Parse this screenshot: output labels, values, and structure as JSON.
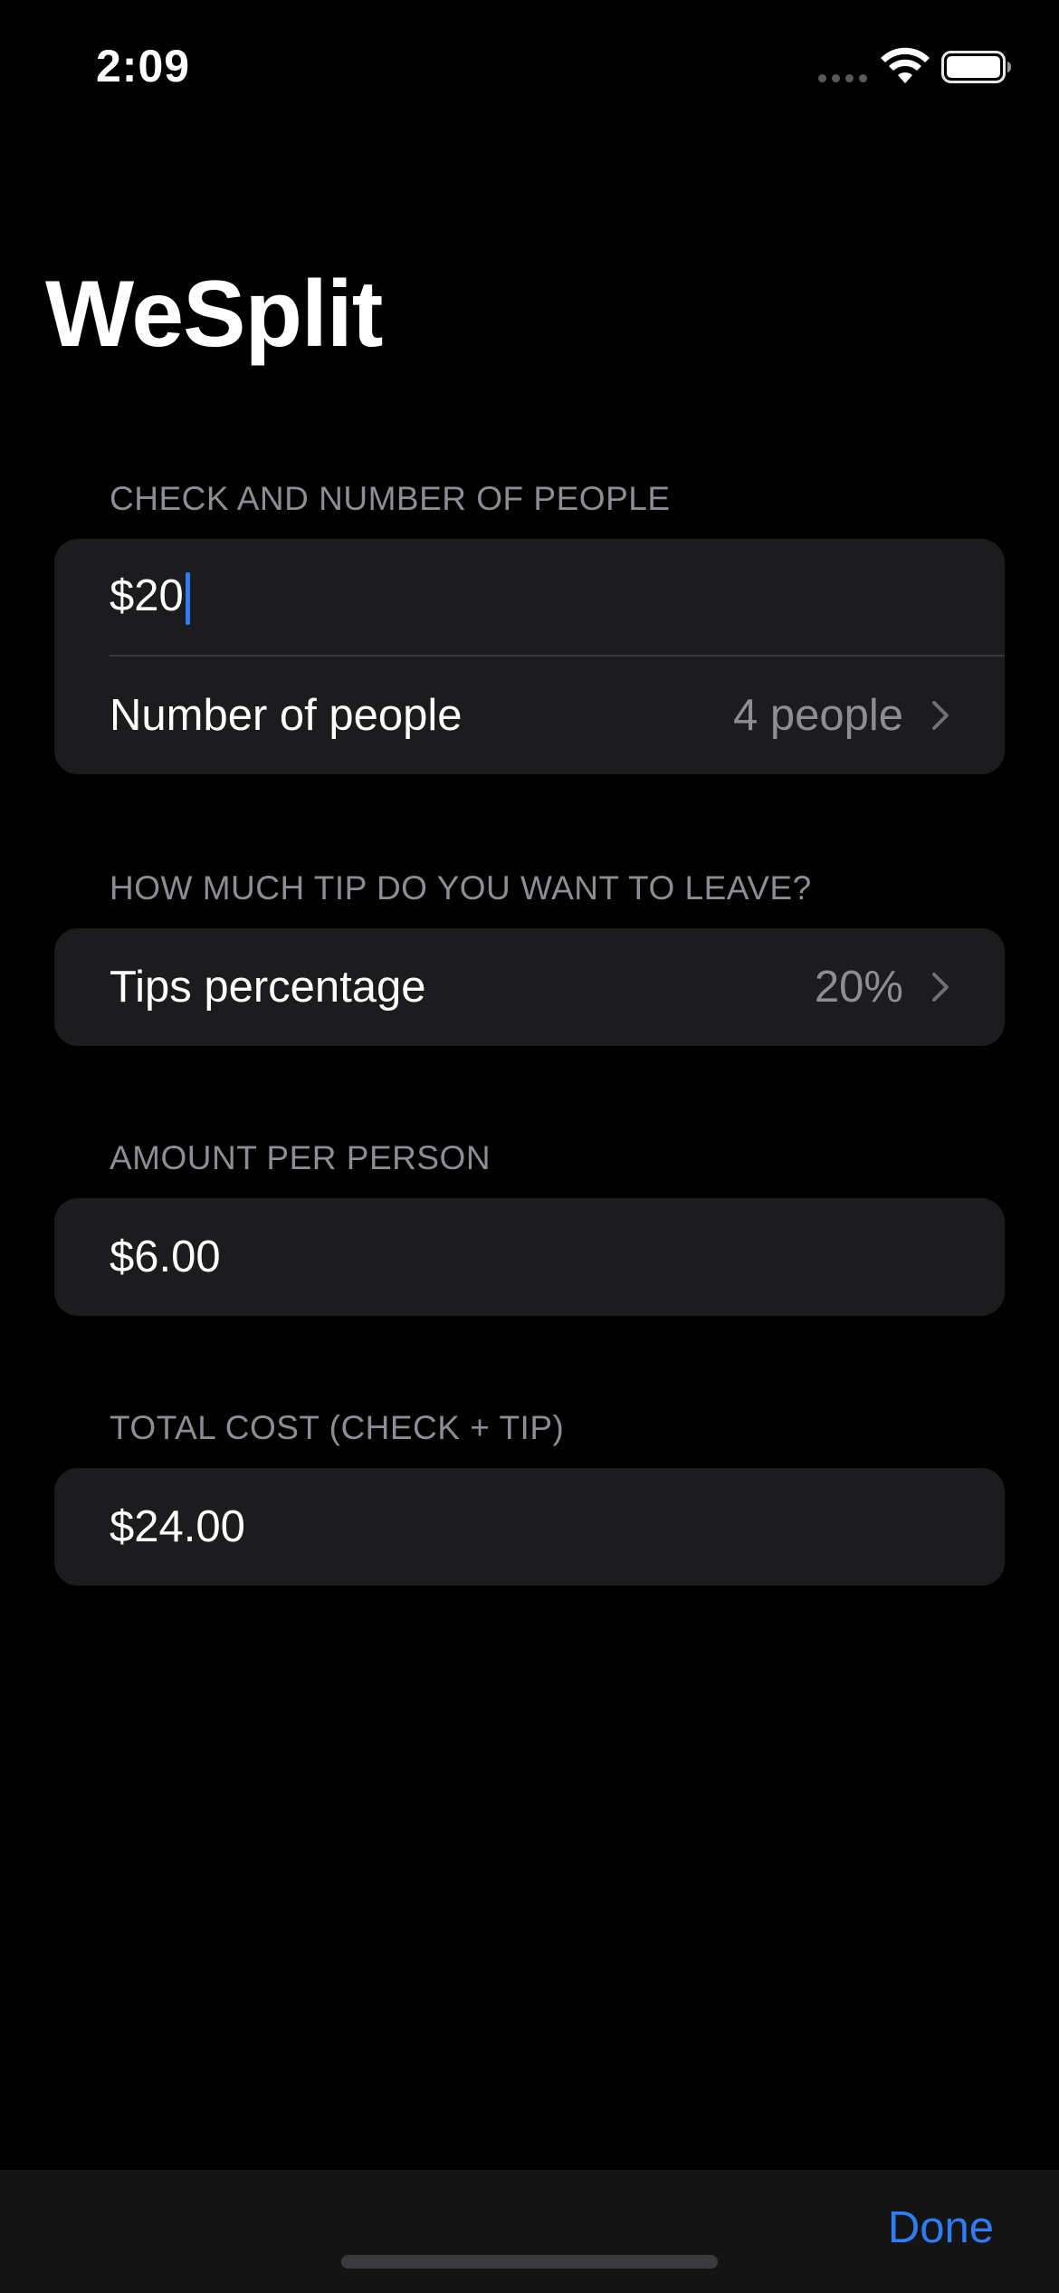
{
  "status_bar": {
    "time": "2:09"
  },
  "title": "WeSplit",
  "sections": {
    "check": {
      "header": "CHECK AND NUMBER OF PEOPLE",
      "check_amount": "$20",
      "people_label": "Number of people",
      "people_value": "4 people"
    },
    "tip": {
      "header": "HOW MUCH TIP DO YOU WANT TO LEAVE?",
      "tip_label": "Tips percentage",
      "tip_value": "20%"
    },
    "per_person": {
      "header": "AMOUNT PER PERSON",
      "amount": "$6.00"
    },
    "total": {
      "header": "TOTAL COST (CHECK + TIP)",
      "amount": "$24.00"
    }
  },
  "keyboard_toolbar": {
    "done_label": "Done"
  },
  "colors": {
    "accent": "#2f7cf6",
    "background": "#000000",
    "card": "#1c1c1e",
    "secondary_text": "#8d8d93"
  }
}
